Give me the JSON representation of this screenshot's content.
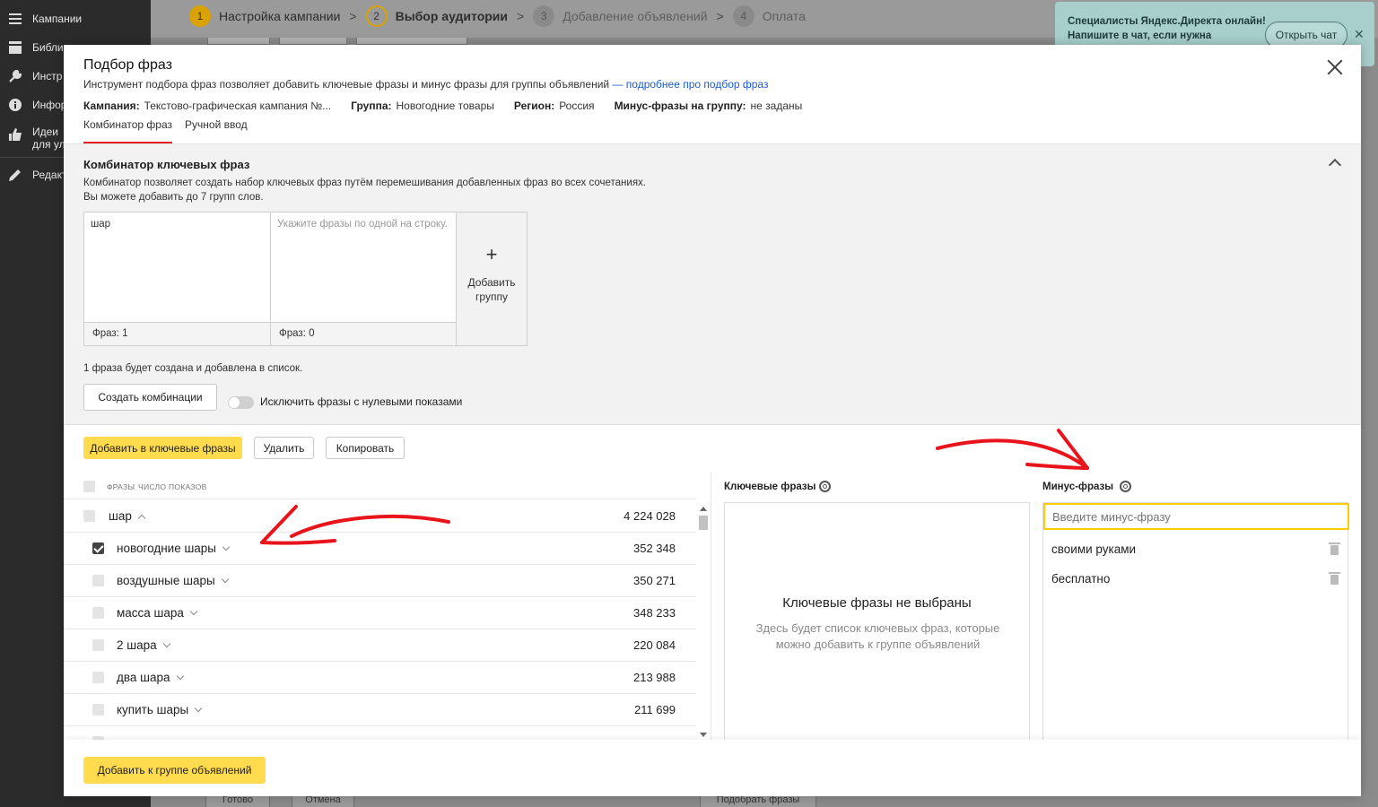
{
  "sidebar": {
    "items": [
      {
        "label": "Кампании",
        "icon": "menu-icon"
      },
      {
        "label": "Библи",
        "icon": "library-icon"
      },
      {
        "label": "Инстр",
        "icon": "wrench-icon"
      },
      {
        "label": "Инфор",
        "icon": "info-icon"
      },
      {
        "label_line1": "Идеи",
        "label_line2": "для ул",
        "icon": "thumbs-up-icon"
      },
      {
        "label": "Редакт",
        "icon": "pencil-icon"
      }
    ]
  },
  "steps": [
    {
      "num": "1",
      "label": "Настройка кампании",
      "state": "done"
    },
    {
      "num": "2",
      "label": "Выбор аудитории",
      "state": "current"
    },
    {
      "num": "3",
      "label": "Добавление объявлений",
      "state": "off"
    },
    {
      "num": "4",
      "label": "Оплата",
      "state": "off"
    }
  ],
  "chat": {
    "text": "Специалисты Яндекс.Директа онлайн! Напишите в чат, если нужна",
    "button": "Открыть чат"
  },
  "background_buttons": {
    "done": "Готово",
    "cancel": "Отмена",
    "pick": "Подобрать фразы"
  },
  "modal": {
    "title": "Подбор фраз",
    "description": "Инструмент подбора фраз позволяет добавить ключевые фразы и минус фразы для группы объявлений",
    "link": "— подробнее про подбор фраз",
    "meta": [
      {
        "key": "Кампания:",
        "value": "Текстово-графическая кампания №..."
      },
      {
        "key": "Группа:",
        "value": "Новогодние товары"
      },
      {
        "key": "Регион:",
        "value": "Россия"
      },
      {
        "key": "Минус-фразы на группу:",
        "value": "не заданы"
      }
    ],
    "tabs": [
      {
        "label": "Комбинатор фраз",
        "active": true
      },
      {
        "label": "Ручной ввод",
        "active": false
      }
    ]
  },
  "combinator": {
    "title": "Комбинатор ключевых фраз",
    "desc_line1": "Комбинатор позволяет создать набор ключевых фраз путём перемешивания добавленных фраз во всех сочетаниях.",
    "desc_line2": "Вы можете добавить до 7 групп слов.",
    "groups": [
      {
        "text": "шар",
        "placeholder": "",
        "count": "Фраз: 1"
      },
      {
        "text": "",
        "placeholder": "Укажите фразы по одной на строку.",
        "count": "Фраз: 0"
      }
    ],
    "add_group_plus": "+",
    "add_group_line1": "Добавить",
    "add_group_line2": "группу",
    "info": "1 фраза будет создана и добавлена в список.",
    "create_button": "Создать комбинации",
    "toggle_label": "Исключить фразы с нулевыми показами",
    "toggle_on": false
  },
  "actions": {
    "add_keywords": "Добавить в ключевые фразы",
    "delete": "Удалить",
    "copy": "Копировать"
  },
  "table": {
    "col_phrases": "ФРАЗЫ",
    "col_shows": "ЧИСЛО ПОКАЗОВ",
    "rows": [
      {
        "phrase": "шар",
        "shows": "4 224 028",
        "checked": false,
        "expanded": true,
        "indent": false
      },
      {
        "phrase": "новогодние шары",
        "shows": "352 348",
        "checked": true,
        "expanded": false,
        "indent": true
      },
      {
        "phrase": "воздушные шары",
        "shows": "350 271",
        "checked": false,
        "expanded": false,
        "indent": true
      },
      {
        "phrase": "масса шара",
        "shows": "348 233",
        "checked": false,
        "expanded": false,
        "indent": true
      },
      {
        "phrase": "2 шара",
        "shows": "220 084",
        "checked": false,
        "expanded": false,
        "indent": true
      },
      {
        "phrase": "два шара",
        "shows": "213 988",
        "checked": false,
        "expanded": false,
        "indent": true
      },
      {
        "phrase": "купить шары",
        "shows": "211 699",
        "checked": false,
        "expanded": false,
        "indent": true
      }
    ]
  },
  "keywords_panel": {
    "title": "Ключевые фразы",
    "empty_title": "Ключевые фразы не выбраны",
    "empty_desc": "Здесь будет список ключевых фраз, которые можно добавить к группе объявлений"
  },
  "minus_panel": {
    "title": "Минус-фразы",
    "placeholder": "Введите минус-фразу",
    "items": [
      "своими руками",
      "бесплатно"
    ]
  },
  "footer": {
    "add_to_group": "Добавить к группе объявлений"
  },
  "colors": {
    "accent_yellow": "#ffdb4d",
    "annotation_red": "#e8141c",
    "tab_underline": "#e31e24",
    "link_blue": "#1a5bd3"
  }
}
